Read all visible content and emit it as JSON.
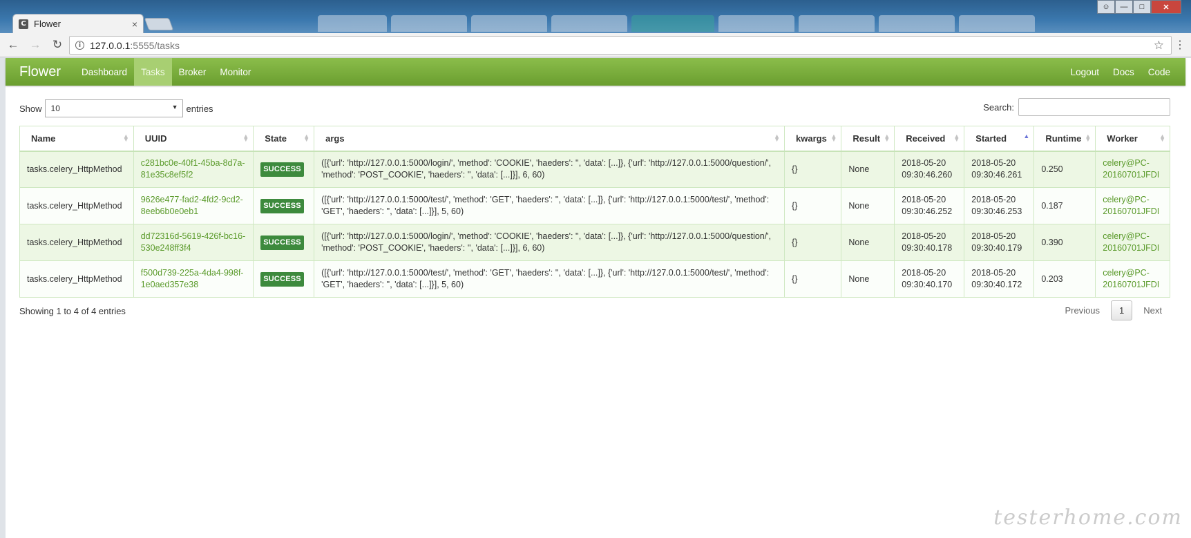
{
  "browser": {
    "tab_title": "Flower",
    "tab_favicon": "C",
    "tab_close": "×",
    "url_host": "127.0.0.1",
    "url_path": ":5555/tasks",
    "icons": [
      "back-icon",
      "forward-icon",
      "reload-icon",
      "info-icon",
      "star-icon",
      "menu-icon"
    ]
  },
  "navbar": {
    "brand": "Flower",
    "left": [
      "Dashboard",
      "Tasks",
      "Broker",
      "Monitor"
    ],
    "active": "Tasks",
    "right": [
      "Logout",
      "Docs",
      "Code"
    ]
  },
  "controls": {
    "show_label": "Show",
    "length_value": "10",
    "entries_label": "entries",
    "search_label": "Search:"
  },
  "table": {
    "headers": [
      "Name",
      "UUID",
      "State",
      "args",
      "kwargs",
      "Result",
      "Received",
      "Started",
      "Runtime",
      "Worker"
    ],
    "sorted_column": "Started",
    "rows": [
      {
        "name": "tasks.celery_HttpMethod",
        "uuid": "c281bc0e-40f1-45ba-8d7a-81e35c8ef5f2",
        "state": "SUCCESS",
        "args": "([{'url': 'http://127.0.0.1:5000/login/', 'method': 'COOKIE', 'haeders': '', 'data': [...]}, {'url': 'http://127.0.0.1:5000/question/', 'method': 'POST_COOKIE', 'haeders': '', 'data': [...]}], 6, 60)",
        "kwargs": "{}",
        "result": "None",
        "received": "2018-05-20 09:30:46.260",
        "started": "2018-05-20 09:30:46.261",
        "runtime": "0.250",
        "worker": "celery@PC-20160701JFDI"
      },
      {
        "name": "tasks.celery_HttpMethod",
        "uuid": "9626e477-fad2-4fd2-9cd2-8eeb6b0e0eb1",
        "state": "SUCCESS",
        "args": "([{'url': 'http://127.0.0.1:5000/test/', 'method': 'GET', 'haeders': '', 'data': [...]}, {'url': 'http://127.0.0.1:5000/test/', 'method': 'GET', 'haeders': '', 'data': [...]}], 5, 60)",
        "kwargs": "{}",
        "result": "None",
        "received": "2018-05-20 09:30:46.252",
        "started": "2018-05-20 09:30:46.253",
        "runtime": "0.187",
        "worker": "celery@PC-20160701JFDI"
      },
      {
        "name": "tasks.celery_HttpMethod",
        "uuid": "dd72316d-5619-426f-bc16-530e248ff3f4",
        "state": "SUCCESS",
        "args": "([{'url': 'http://127.0.0.1:5000/login/', 'method': 'COOKIE', 'haeders': '', 'data': [...]}, {'url': 'http://127.0.0.1:5000/question/', 'method': 'POST_COOKIE', 'haeders': '', 'data': [...]}], 6, 60)",
        "kwargs": "{}",
        "result": "None",
        "received": "2018-05-20 09:30:40.178",
        "started": "2018-05-20 09:30:40.179",
        "runtime": "0.390",
        "worker": "celery@PC-20160701JFDI"
      },
      {
        "name": "tasks.celery_HttpMethod",
        "uuid": "f500d739-225a-4da4-998f-1e0aed357e38",
        "state": "SUCCESS",
        "args": "([{'url': 'http://127.0.0.1:5000/test/', 'method': 'GET', 'haeders': '', 'data': [...]}, {'url': 'http://127.0.0.1:5000/test/', 'method': 'GET', 'haeders': '', 'data': [...]}], 5, 60)",
        "kwargs": "{}",
        "result": "None",
        "received": "2018-05-20 09:30:40.170",
        "started": "2018-05-20 09:30:40.172",
        "runtime": "0.203",
        "worker": "celery@PC-20160701JFDI"
      }
    ]
  },
  "footer": {
    "info": "Showing 1 to 4 of 4 entries",
    "previous": "Previous",
    "page": "1",
    "next": "Next"
  },
  "watermark": "testerhome.com",
  "colors": {
    "navbar_top": "#8bbd4b",
    "navbar_bottom": "#6a9e2f",
    "nav_active": "#a8cf72",
    "success_badge": "#3d8a3d",
    "link_green": "#5a9a2a",
    "row_odd": "#edf7e4"
  }
}
